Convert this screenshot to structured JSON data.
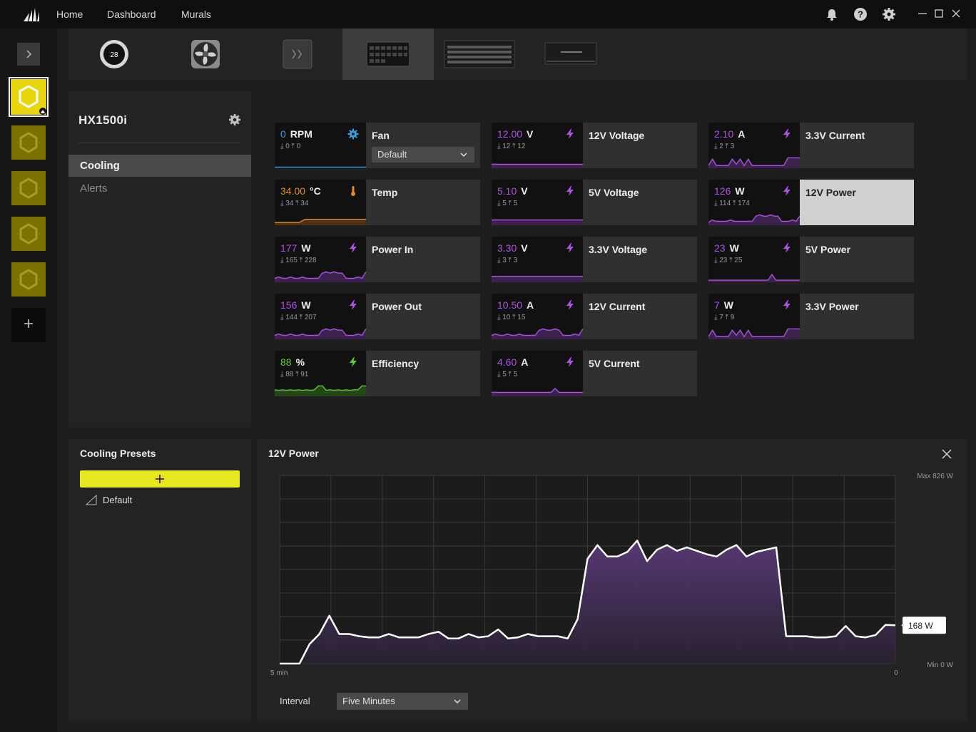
{
  "nav": {
    "items": [
      "Home",
      "Dashboard",
      "Murals"
    ]
  },
  "icons": {
    "top_right": [
      "bell-icon",
      "help-icon",
      "gear-icon"
    ],
    "window": [
      "minimize-icon",
      "maximize-icon",
      "close-icon"
    ]
  },
  "devices": [
    {
      "name": "round-lcd-device-icon",
      "badge": "28"
    },
    {
      "name": "fan-device-icon"
    },
    {
      "name": "hub-device-icon"
    },
    {
      "name": "psu-device-icon",
      "active": true
    },
    {
      "name": "keyboard-device-icon"
    },
    {
      "name": "memory-device-icon"
    }
  ],
  "device_panel": {
    "title": "HX1500i",
    "menu": [
      {
        "label": "Cooling",
        "active": true
      },
      {
        "label": "Alerts",
        "active": false
      }
    ]
  },
  "colors": {
    "accent_yellow": "#e8e620",
    "purple": "#b050e8",
    "orange": "#e88a20",
    "green": "#5ad030",
    "blue": "#33a0e8"
  },
  "tiles": [
    {
      "id": "fan",
      "value": "0",
      "unit": "RPM",
      "min": "0",
      "max": "0",
      "label": "Fan",
      "icon": "gear-icon",
      "color": "#33a0e8",
      "select": "Default",
      "spark": []
    },
    {
      "id": "12v-voltage",
      "value": "12.00",
      "unit": "V",
      "min": "12",
      "max": "12",
      "label": "12V Voltage",
      "icon": "bolt-icon",
      "color": "#b050e8",
      "spark": [
        0.2,
        0.2,
        0.2,
        0.2,
        0.2,
        0.2,
        0.2,
        0.2,
        0.2,
        0.2,
        0.2,
        0.2,
        0.2,
        0.2,
        0.2,
        0.2
      ]
    },
    {
      "id": "3v3-current",
      "value": "2.10",
      "unit": "A",
      "min": "2",
      "max": "3",
      "label": "3.3V Current",
      "icon": "bolt-icon",
      "color": "#b050e8",
      "spark": [
        0.1,
        0.6,
        0.1,
        0.1,
        0.1,
        0.1,
        0.6,
        0.2,
        0.6,
        0.1,
        0.6,
        0.1,
        0.1,
        0.1,
        0.1,
        0.1,
        0.1,
        0.1,
        0.1,
        0.1,
        0.7,
        0.7,
        0.7,
        0.7
      ]
    },
    {
      "id": "temp",
      "value": "34.00",
      "unit": "°C",
      "min": "34",
      "max": "34",
      "label": "Temp",
      "icon": "thermometer-icon",
      "color": "#e88a20",
      "spark": [
        0.1,
        0.1,
        0.1,
        0.1,
        0.1,
        0.35,
        0.35,
        0.35,
        0.35,
        0.35,
        0.35,
        0.35,
        0.35,
        0.35,
        0.35,
        0.35
      ]
    },
    {
      "id": "5v-voltage",
      "value": "5.10",
      "unit": "V",
      "min": "5",
      "max": "5",
      "label": "5V Voltage",
      "icon": "bolt-icon",
      "color": "#b050e8",
      "spark": [
        0.3,
        0.3,
        0.3,
        0.3,
        0.3,
        0.3,
        0.3,
        0.3,
        0.3,
        0.3,
        0.3,
        0.3,
        0.3,
        0.3,
        0.3,
        0.3
      ]
    },
    {
      "id": "12v-power",
      "value": "126",
      "unit": "W",
      "min": "114",
      "max": "174",
      "label": "12V Power",
      "icon": "bolt-icon",
      "color": "#b050e8",
      "selected": true,
      "spark": [
        0.1,
        0.3,
        0.2,
        0.2,
        0.2,
        0.2,
        0.3,
        0.2,
        0.2,
        0.2,
        0.2,
        0.2,
        0.2,
        0.6,
        0.7,
        0.6,
        0.6,
        0.7,
        0.6,
        0.6,
        0.2,
        0.2,
        0.2,
        0.3,
        0.2,
        0.6
      ]
    },
    {
      "id": "power-in",
      "value": "177",
      "unit": "W",
      "min": "165",
      "max": "228",
      "label": "Power In",
      "icon": "bolt-icon",
      "color": "#b050e8",
      "spark": [
        0.2,
        0.3,
        0.2,
        0.2,
        0.3,
        0.2,
        0.2,
        0.3,
        0.2,
        0.2,
        0.2,
        0.2,
        0.6,
        0.7,
        0.6,
        0.7,
        0.6,
        0.6,
        0.2,
        0.2,
        0.2,
        0.3,
        0.2,
        0.7
      ]
    },
    {
      "id": "3v3-voltage",
      "value": "3.30",
      "unit": "V",
      "min": "3",
      "max": "3",
      "label": "3.3V Voltage",
      "icon": "bolt-icon",
      "color": "#b050e8",
      "spark": [
        0.35,
        0.35,
        0.35,
        0.35,
        0.35,
        0.35,
        0.35,
        0.35,
        0.35,
        0.35,
        0.35,
        0.35,
        0.35,
        0.35,
        0.35,
        0.35
      ]
    },
    {
      "id": "5v-power",
      "value": "23",
      "unit": "W",
      "min": "23",
      "max": "25",
      "label": "5V Power",
      "icon": "bolt-icon",
      "color": "#b050e8",
      "spark": [
        0.05,
        0.05,
        0.05,
        0.05,
        0.05,
        0.05,
        0.05,
        0.05,
        0.05,
        0.05,
        0.05,
        0.05,
        0.05,
        0.05,
        0.05,
        0.05,
        0.5,
        0.05,
        0.05,
        0.05,
        0.05,
        0.05,
        0.05,
        0.05
      ]
    },
    {
      "id": "power-out",
      "value": "156",
      "unit": "W",
      "min": "144",
      "max": "207",
      "label": "Power Out",
      "icon": "bolt-icon",
      "color": "#b050e8",
      "spark": [
        0.2,
        0.3,
        0.2,
        0.2,
        0.3,
        0.2,
        0.2,
        0.3,
        0.2,
        0.2,
        0.2,
        0.2,
        0.6,
        0.7,
        0.6,
        0.7,
        0.6,
        0.6,
        0.2,
        0.2,
        0.2,
        0.3,
        0.2,
        0.7
      ]
    },
    {
      "id": "12v-current",
      "value": "10.50",
      "unit": "A",
      "min": "10",
      "max": "15",
      "label": "12V Current",
      "icon": "bolt-icon",
      "color": "#b050e8",
      "spark": [
        0.2,
        0.3,
        0.2,
        0.2,
        0.3,
        0.2,
        0.2,
        0.3,
        0.2,
        0.2,
        0.2,
        0.2,
        0.6,
        0.7,
        0.6,
        0.6,
        0.7,
        0.6,
        0.2,
        0.2,
        0.2,
        0.3,
        0.2,
        0.7
      ]
    },
    {
      "id": "3v3-power",
      "value": "7",
      "unit": "W",
      "min": "7",
      "max": "9",
      "label": "3.3V Power",
      "icon": "bolt-icon",
      "color": "#b050e8",
      "spark": [
        0.1,
        0.6,
        0.1,
        0.1,
        0.1,
        0.1,
        0.6,
        0.2,
        0.6,
        0.1,
        0.6,
        0.1,
        0.1,
        0.1,
        0.1,
        0.1,
        0.1,
        0.1,
        0.1,
        0.1,
        0.7,
        0.7,
        0.7,
        0.7
      ]
    },
    {
      "id": "efficiency",
      "value": "88",
      "unit": "%",
      "min": "88",
      "max": "91",
      "label": "Efficiency",
      "icon": "bolt-icon",
      "color": "#5ad030",
      "spark": [
        0.4,
        0.35,
        0.4,
        0.35,
        0.4,
        0.35,
        0.4,
        0.35,
        0.4,
        0.35,
        0.4,
        0.7,
        0.7,
        0.35,
        0.4,
        0.35,
        0.4,
        0.35,
        0.4,
        0.35,
        0.4,
        0.4,
        0.7,
        0.7
      ]
    },
    {
      "id": "5v-current",
      "value": "4.60",
      "unit": "A",
      "min": "5",
      "max": "5",
      "label": "5V Current",
      "icon": "bolt-icon",
      "color": "#b050e8",
      "spark": [
        0.2,
        0.2,
        0.2,
        0.2,
        0.2,
        0.2,
        0.2,
        0.2,
        0.2,
        0.2,
        0.2,
        0.2,
        0.2,
        0.2,
        0.2,
        0.2,
        0.5,
        0.2,
        0.2,
        0.2,
        0.2,
        0.2,
        0.2,
        0.2
      ]
    }
  ],
  "presets": {
    "title": "Cooling Presets",
    "items": [
      "Default"
    ]
  },
  "chart_panel": {
    "title": "12V Power",
    "interval_label": "Interval",
    "interval_value": "Five Minutes"
  },
  "chart_data": {
    "type": "area",
    "title": "12V Power",
    "x_start_label": "5 min",
    "x_end_label": "0",
    "y_max_label": "Max 826 W",
    "y_min_label": "Min 0 W",
    "current_label": "168 W",
    "ylim": [
      0,
      826
    ],
    "grid": true,
    "values": [
      0,
      0,
      0,
      85,
      130,
      210,
      130,
      130,
      120,
      115,
      115,
      130,
      115,
      115,
      115,
      130,
      140,
      110,
      110,
      130,
      115,
      120,
      150,
      110,
      115,
      130,
      120,
      120,
      120,
      110,
      195,
      460,
      520,
      470,
      470,
      490,
      540,
      450,
      500,
      520,
      495,
      510,
      495,
      480,
      470,
      500,
      520,
      470,
      490,
      500,
      510,
      120,
      120,
      120,
      115,
      115,
      120,
      165,
      120,
      115,
      125,
      170,
      168
    ]
  }
}
